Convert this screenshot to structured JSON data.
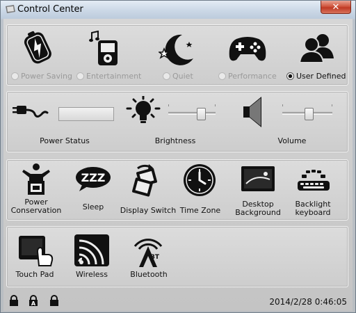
{
  "window": {
    "title": "Control Center",
    "close_glyph": "✕"
  },
  "modes": {
    "items": [
      {
        "label": "Power Saving",
        "icon": "battery-bolt-icon",
        "selected": false
      },
      {
        "label": "Entertainment",
        "icon": "music-player-icon",
        "selected": false
      },
      {
        "label": "Quiet",
        "icon": "moon-stars-icon",
        "selected": false
      },
      {
        "label": "Performance",
        "icon": "gamepad-icon",
        "selected": false
      },
      {
        "label": "User Defined",
        "icon": "users-icon",
        "selected": true
      }
    ]
  },
  "controls": {
    "power_status": {
      "label": "Power Status",
      "icon": "power-plug-icon"
    },
    "brightness": {
      "label": "Brightness",
      "icon": "light-bulb-icon",
      "level": 0.75
    },
    "volume": {
      "label": "Volume",
      "icon": "speaker-icon",
      "level": 0.55
    }
  },
  "functions": {
    "items": [
      {
        "label": "Power Conservation",
        "icon": "power-conservation-icon"
      },
      {
        "label": "Sleep",
        "icon": "sleep-zzz-icon"
      },
      {
        "label": "Display Switch",
        "icon": "display-switch-icon"
      },
      {
        "label": "Time Zone",
        "icon": "clock-icon"
      },
      {
        "label": "Desktop Background",
        "icon": "desktop-background-icon"
      },
      {
        "label": "Backlight keyboard",
        "icon": "backlight-keyboard-icon"
      }
    ]
  },
  "devices": {
    "items": [
      {
        "label": "Touch Pad",
        "icon": "touchpad-icon"
      },
      {
        "label": "Wireless",
        "icon": "wireless-icon"
      },
      {
        "label": "Bluetooth",
        "icon": "bluetooth-icon"
      }
    ]
  },
  "status": {
    "locks": [
      {
        "name": "padlock-icon",
        "letter": ""
      },
      {
        "name": "caps-lock-icon",
        "letter": "A"
      },
      {
        "name": "scroll-lock-icon",
        "letter": ""
      }
    ],
    "datetime": "2014/2/28 0:46:05"
  }
}
